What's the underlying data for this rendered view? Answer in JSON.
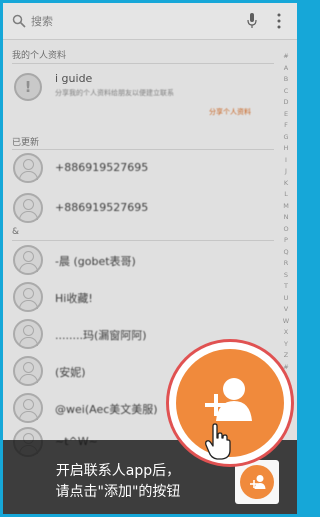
{
  "search": {
    "placeholder": "搜索"
  },
  "sections": {
    "profile": "我的个人资料",
    "updated": "已更新",
    "amp": "&"
  },
  "guide": {
    "icon": "!",
    "title": "i guide",
    "description": "分享我的个人资料给朋友以便建立联系",
    "link": "分享个人资料"
  },
  "contacts_updated": [
    {
      "name": "+886919527695"
    },
    {
      "name": "+886919527695"
    }
  ],
  "contacts_amp": [
    {
      "name": "-晨 (gobet表哥)"
    },
    {
      "name": "Hi收藏!"
    },
    {
      "name": "........玛(漏窗阿阿)"
    },
    {
      "name": "(安妮)"
    },
    {
      "name": "@wei(Aec美文美服)"
    },
    {
      "name": "~t^W~"
    }
  ],
  "index_letters": [
    "#",
    "A",
    "B",
    "C",
    "D",
    "E",
    "F",
    "G",
    "H",
    "I",
    "J",
    "K",
    "L",
    "M",
    "N",
    "O",
    "P",
    "Q",
    "R",
    "S",
    "T",
    "U",
    "V",
    "W",
    "X",
    "Y",
    "Z",
    "#"
  ],
  "tip": {
    "line1": "开启联系人app后，",
    "line2": "请点击\"添加\"的按钮"
  },
  "colors": {
    "accent": "#f08a3c",
    "frame": "#16a7d8",
    "ring": "#e05252"
  },
  "icons": {
    "search": "magnifier",
    "mic": "microphone",
    "more": "vertical-ellipsis",
    "add_contact": "person-plus",
    "hand": "pointing-hand"
  }
}
